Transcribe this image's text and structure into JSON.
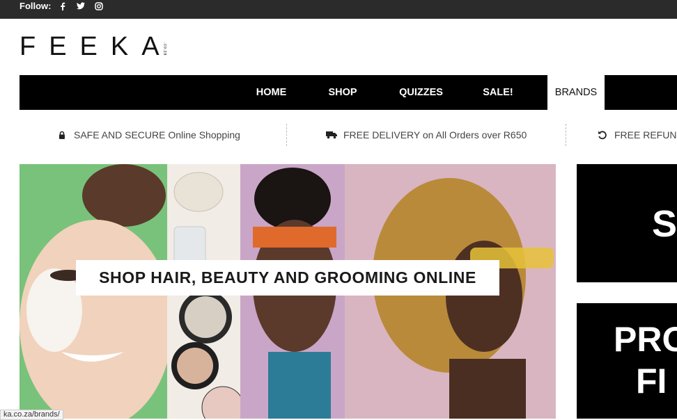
{
  "topbar": {
    "follow_label": "Follow:",
    "icons": [
      "facebook-icon",
      "twitter-icon",
      "instagram-icon"
    ]
  },
  "logo": {
    "word": "FEEKA",
    "tld": ".co.za"
  },
  "nav": {
    "items": [
      {
        "label": "HOME"
      },
      {
        "label": "SHOP"
      },
      {
        "label": "QUIZZES"
      },
      {
        "label": "SALE!"
      },
      {
        "label": "BRANDS",
        "active": true
      }
    ]
  },
  "usp": [
    {
      "icon": "lock-icon",
      "text": "SAFE AND SECURE Online Shopping"
    },
    {
      "icon": "truck-icon",
      "text": "FREE DELIVERY on All Orders over R650"
    },
    {
      "icon": "refresh-icon",
      "text": "FREE REFUNDS"
    }
  ],
  "hero": {
    "banner_text": "SHOP HAIR, BEAUTY AND GROOMING ONLINE"
  },
  "side_banners": {
    "first_text": "S",
    "second_line1": "PRO",
    "second_line2": "FI"
  },
  "status": {
    "url": "ka.co.za/brands/"
  },
  "colors": {
    "topbar": "#2b2b2b",
    "nav": "#000000",
    "accent": "#ffffff"
  }
}
